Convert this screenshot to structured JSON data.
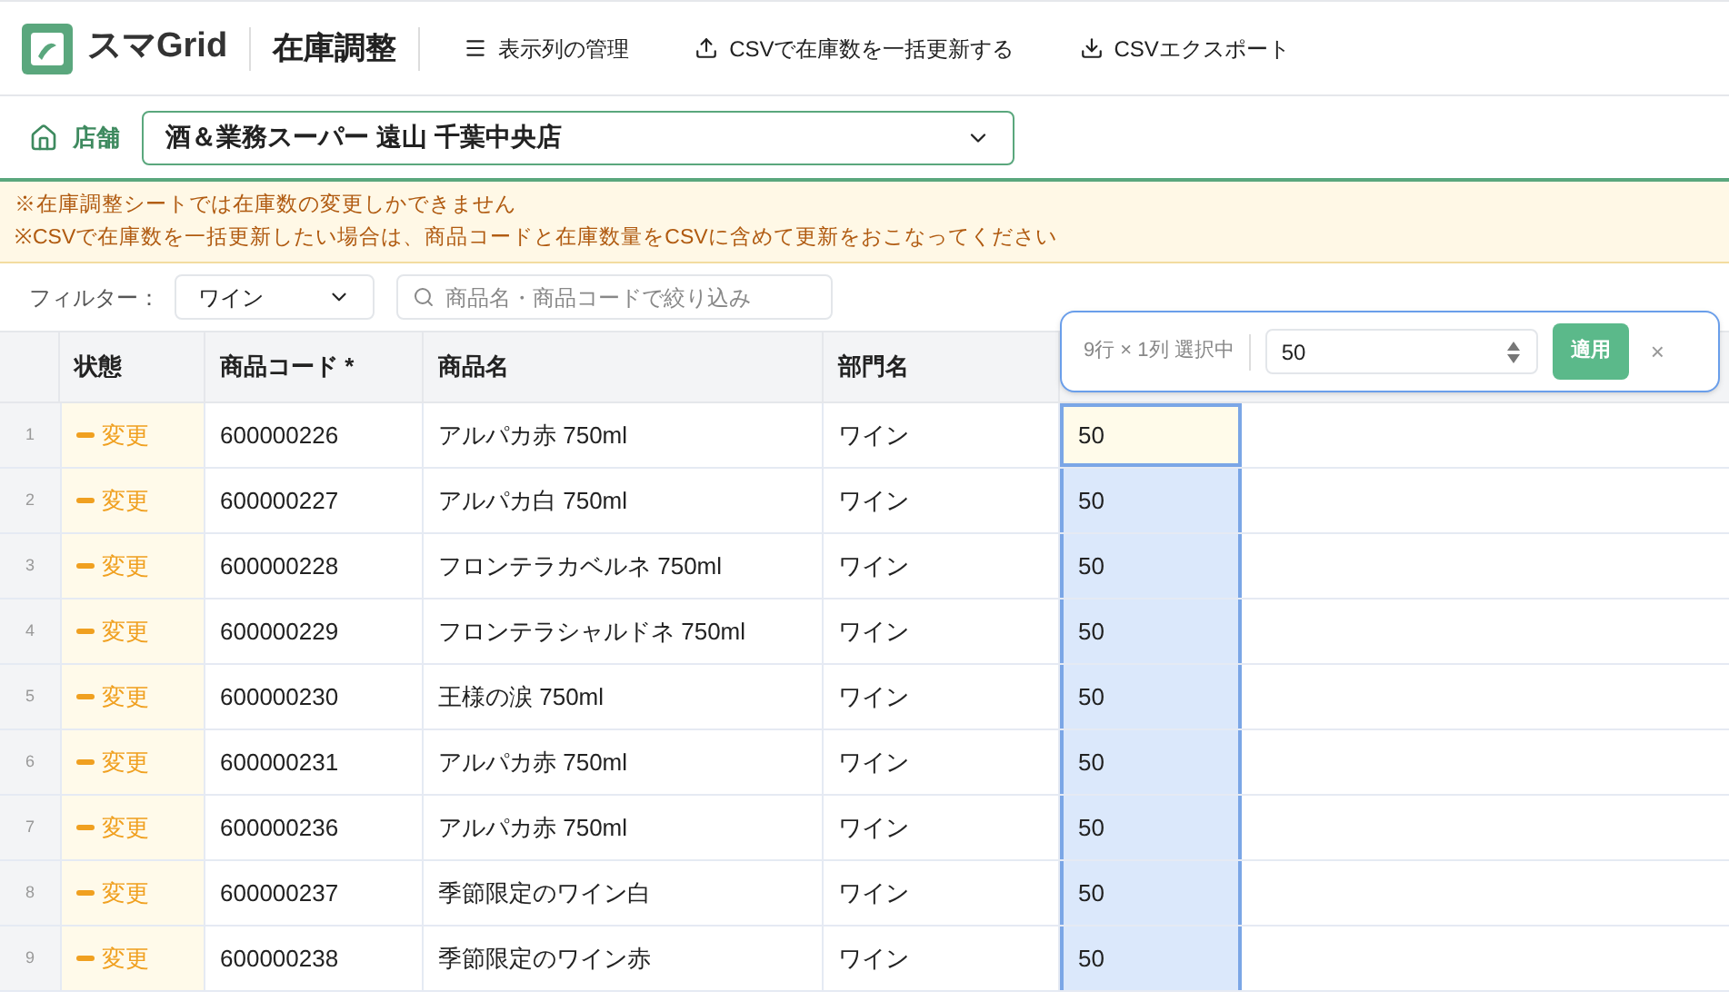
{
  "app": {
    "name": "スマGrid",
    "page_title": "在庫調整"
  },
  "toolbar": [
    {
      "kind": "menu",
      "label": "表示列の管理"
    },
    {
      "kind": "upload",
      "label": "CSVで在庫数を一括更新する"
    },
    {
      "kind": "download",
      "label": "CSVエクスポート"
    }
  ],
  "store": {
    "label": "店舗",
    "value": "酒＆業務スーパー 遠山 千葉中央店"
  },
  "notices": [
    "※在庫調整シートでは在庫数の変更しかできません",
    "※CSVで在庫数を一括更新したい場合は、商品コードと在庫数量をCSVに含めて更新をおこなってください"
  ],
  "filter": {
    "label": "フィルター：",
    "value": "ワイン",
    "search_placeholder": "商品名・商品コードで絞り込み"
  },
  "bulk_edit": {
    "selection": "9行 × 1列 選択中",
    "value": "50",
    "apply": "適用",
    "close": "×"
  },
  "table": {
    "columns": [
      "状態",
      "商品コード *",
      "商品名",
      "部門名"
    ],
    "rows": [
      {
        "number": "1",
        "status": "変更",
        "code": "600000226",
        "name": "アルパカ赤 750ml",
        "dept": "ワイン",
        "stock": "50",
        "selected": true,
        "active": true
      },
      {
        "number": "2",
        "status": "変更",
        "code": "600000227",
        "name": "アルパカ白 750ml",
        "dept": "ワイン",
        "stock": "50",
        "selected": true,
        "active": false
      },
      {
        "number": "3",
        "status": "変更",
        "code": "600000228",
        "name": "フロンテラカベルネ 750ml",
        "dept": "ワイン",
        "stock": "50",
        "selected": true,
        "active": false
      },
      {
        "number": "4",
        "status": "変更",
        "code": "600000229",
        "name": "フロンテラシャルドネ 750ml",
        "dept": "ワイン",
        "stock": "50",
        "selected": true,
        "active": false
      },
      {
        "number": "5",
        "status": "変更",
        "code": "600000230",
        "name": "王様の涙 750ml",
        "dept": "ワイン",
        "stock": "50",
        "selected": true,
        "active": false
      },
      {
        "number": "6",
        "status": "変更",
        "code": "600000231",
        "name": "アルパカ赤 750ml",
        "dept": "ワイン",
        "stock": "50",
        "selected": true,
        "active": false
      },
      {
        "number": "7",
        "status": "変更",
        "code": "600000236",
        "name": "アルパカ赤 750ml",
        "dept": "ワイン",
        "stock": "50",
        "selected": true,
        "active": false
      },
      {
        "number": "8",
        "status": "変更",
        "code": "600000237",
        "name": "季節限定のワイン白",
        "dept": "ワイン",
        "stock": "50",
        "selected": true,
        "active": false
      },
      {
        "number": "9",
        "status": "変更",
        "code": "600000238",
        "name": "季節限定のワイン赤",
        "dept": "ワイン",
        "stock": "50",
        "selected": true,
        "active": false
      }
    ]
  }
}
